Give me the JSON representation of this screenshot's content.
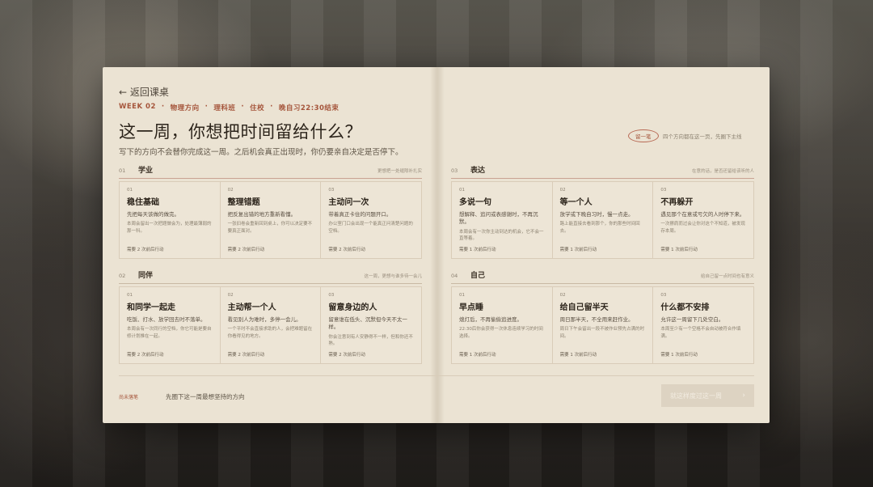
{
  "header": {
    "back_label": "← 返回课桌",
    "meta": [
      "WEEK 02",
      "物理方向",
      "理科班",
      "住校",
      "晚自习22:30结束"
    ],
    "meta_sep": "·",
    "title": "这一周，你想把时间留给什么？",
    "subtitle": "写下的方向不会替你完成这一周。之后机会真正出现时，你仍要亲自决定是否停下。",
    "stamp": "留一笔",
    "stamp_note": "四个方向都在这一页，先圈下主线"
  },
  "groups": [
    {
      "num": "01",
      "name": "学业",
      "hint": "更想把一处缝隙补扎实",
      "cards": [
        {
          "num": "01",
          "title": "稳住基础",
          "line": "先把每天该做的做完。",
          "desc": "本周会留出一次把题做会为，处理最薄弱的那一科。",
          "foot": "需要 2 次前后行动"
        },
        {
          "num": "02",
          "title": "整理错题",
          "line": "把反复出错的地方重新看懂。",
          "desc": "一张旧卷会重新回到桌上，你可以决定要不要真正面对。",
          "foot": "需要 2 次前后行动"
        },
        {
          "num": "03",
          "title": "主动问一次",
          "line": "带着真正卡住的问题开口。",
          "desc": "办公室门口会出现一个能真正问清楚问题的空档。",
          "foot": "需要 2 次前后行动"
        }
      ]
    },
    {
      "num": "02",
      "name": "同伴",
      "hint": "这一周，更想与谁多待一会儿",
      "cards": [
        {
          "num": "01",
          "title": "和同学一起走",
          "line": "吃饭、打水、放学回去时不落单。",
          "desc": "本周会有一次同行的空档，你它可能是要自修计划推在一起。",
          "foot": "需要 2 次前后行动"
        },
        {
          "num": "02",
          "title": "主动帮一个人",
          "line": "看见别人为难时，多停一会儿。",
          "desc": "一个平时不会直接求助的人，会把难题留在你看得见的地方。",
          "foot": "需要 2 次前后行动"
        },
        {
          "num": "03",
          "title": "留意身边的人",
          "line": "留意谁在低头、沉默但今天不太一样。",
          "desc": "你会注意到有人安静得不一样，但和你还不熟。",
          "foot": "需要 2 次前后行动"
        }
      ]
    },
    {
      "num": "03",
      "name": "表达",
      "hint": "在意的话，是否还留给该听的人",
      "cards": [
        {
          "num": "01",
          "title": "多说一句",
          "line": "想解释、追问或表感谢时，不再沉默。",
          "desc": "本周会有一次你主动到达的机会，它不会一直等着。",
          "foot": "需要 1 次前后行动"
        },
        {
          "num": "02",
          "title": "等一个人",
          "line": "放学或下晚自习时，慢一点走。",
          "desc": "路上能直接去看到那个，你的那些时间回去。",
          "foot": "需要 1 次前后行动"
        },
        {
          "num": "03",
          "title": "不再躲开",
          "line": "遇见那个在意或亏欠的人时停下来。",
          "desc": "一次擦肩而过会让你对这个不知道，被发现存本周。",
          "foot": "需要 1 次前后行动"
        }
      ]
    },
    {
      "num": "04",
      "name": "自己",
      "hint": "给自己留一点时间也有意义",
      "cards": [
        {
          "num": "01",
          "title": "早点睡",
          "line": "熄灯后，不再偷偷追进度。",
          "desc": "22:30后你会获得一次休息连续学习的时间选择。",
          "foot": "需要 1 次前后行动"
        },
        {
          "num": "02",
          "title": "给自己留半天",
          "line": "周日那半天，不全用来赶作业。",
          "desc": "周日下午会留出一段不被作业预先占满的时间。",
          "foot": "需要 1 次前后行动"
        },
        {
          "num": "03",
          "title": "什么都不安排",
          "line": "允许这一周留下几处空白。",
          "desc": "本周至少有一个空格不会自动被符合作填满。",
          "foot": "需要 1 次前后行动"
        }
      ]
    }
  ],
  "footer": {
    "status": "尚未落笔",
    "hint": "先圈下这一周最想坚持的方向",
    "confirm_label": "就这样度过这一周",
    "confirm_arrow": "›"
  },
  "colors": {
    "accent": "#a5553b",
    "paper": "#ebe3d3",
    "ink": "#2c241b"
  }
}
